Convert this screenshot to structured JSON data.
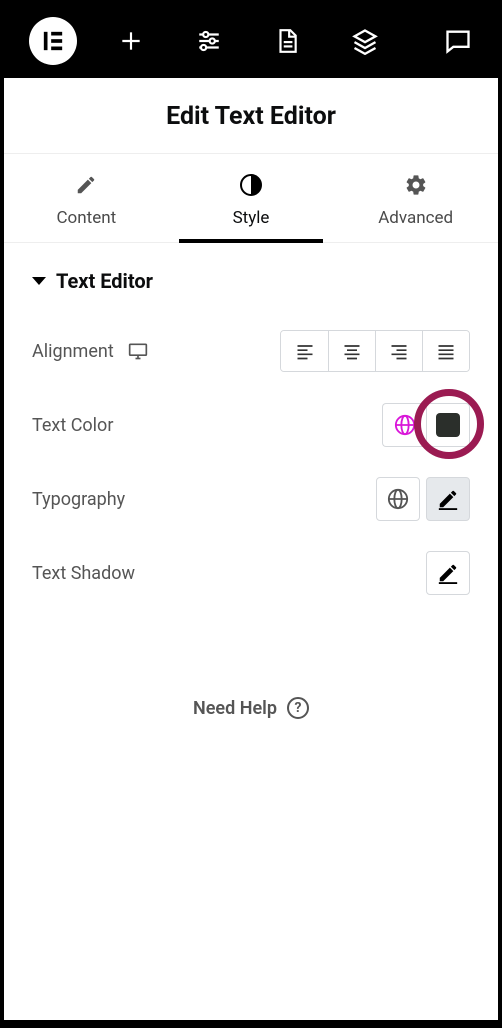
{
  "title": "Edit Text Editor",
  "tabs": {
    "content": "Content",
    "style": "Style",
    "advanced": "Advanced"
  },
  "section": {
    "title": "Text Editor"
  },
  "controls": {
    "alignment": "Alignment",
    "text_color": "Text Color",
    "typography": "Typography",
    "text_shadow": "Text Shadow"
  },
  "help": "Need Help",
  "colors": {
    "text_color_swatch": "#2b2f2b",
    "globe_active": "#d916d9"
  }
}
